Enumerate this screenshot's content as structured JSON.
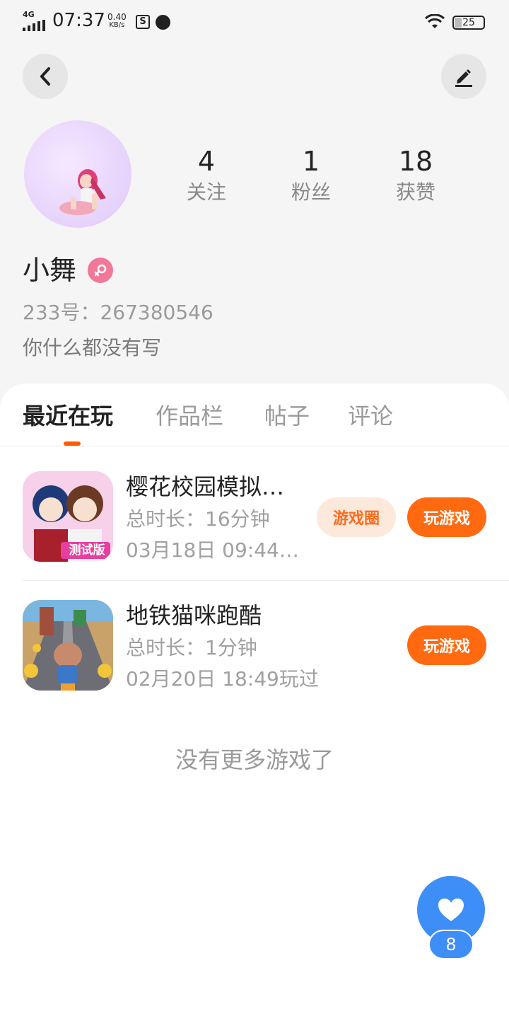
{
  "status_bar": {
    "network": "4G",
    "time": "07:37",
    "speed_value": "0.40",
    "speed_unit": "KB/s",
    "battery": "25"
  },
  "header": {
    "back_icon": "chevron-left-icon",
    "edit_icon": "pen-edit-icon"
  },
  "profile": {
    "name": "小舞",
    "gender": "female",
    "id_line": "233号：267380546",
    "bio": "你什么都没有写",
    "stats": [
      {
        "value": "4",
        "label": "关注"
      },
      {
        "value": "1",
        "label": "粉丝"
      },
      {
        "value": "18",
        "label": "获赞"
      }
    ]
  },
  "tabs": [
    {
      "label": "最近在玩",
      "active": true
    },
    {
      "label": "作品栏",
      "active": false
    },
    {
      "label": "帖子",
      "active": false
    },
    {
      "label": "评论",
      "active": false
    }
  ],
  "games": [
    {
      "title": "樱花校园模拟…",
      "duration": "总时长：16分钟",
      "last_played": "03月18日 09:44…",
      "circle_button": "游戏圈",
      "play_button": "玩游戏",
      "icon_badge": "测试版"
    },
    {
      "title": "地铁猫咪跑酷",
      "duration": "总时长：1分钟",
      "last_played": "02月20日 18:49玩过",
      "play_button": "玩游戏"
    }
  ],
  "footer_text": "没有更多游戏了",
  "like_fab": {
    "icon": "heart-icon",
    "count": "8"
  },
  "colors": {
    "accent": "#ff6a10",
    "fab": "#3e8ef7",
    "gender": "#f2789a"
  }
}
